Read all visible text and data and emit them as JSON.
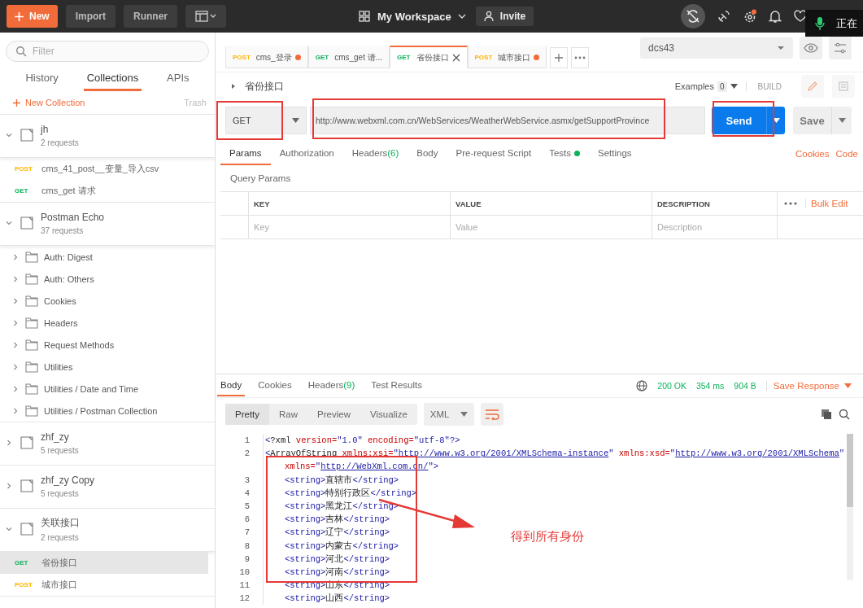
{
  "topbar": {
    "new_button": "New",
    "import_button": "Import",
    "runner_button": "Runner",
    "workspace": "My Workspace",
    "invite_button": "Invite",
    "voice_popup": "正在"
  },
  "sidebar": {
    "filter_placeholder": "Filter",
    "tabs": [
      {
        "label": "History",
        "selected": false
      },
      {
        "label": "Collections",
        "selected": true
      },
      {
        "label": "APIs",
        "selected": false
      }
    ],
    "new_collection": "New Collection",
    "trash": "Trash",
    "collections": [
      {
        "name": "jh",
        "count": "2 requests",
        "expanded": true,
        "children": [
          {
            "kind": "request",
            "method": "POST",
            "color": "#ffb400",
            "name": "cms_41_post__变量_导入csv",
            "selected": false
          },
          {
            "kind": "request",
            "method": "GET",
            "color": "#0cb25c",
            "name": "cms_get 请求",
            "selected": false
          }
        ]
      },
      {
        "name": "Postman Echo",
        "count": "37 requests",
        "expanded": true,
        "children": [
          {
            "kind": "folder",
            "name": "Auth: Digest",
            "expanded": false
          },
          {
            "kind": "folder",
            "name": "Auth: Others",
            "expanded": false
          },
          {
            "kind": "folder",
            "name": "Cookies",
            "expanded": false
          },
          {
            "kind": "folder",
            "name": "Headers",
            "expanded": false
          },
          {
            "kind": "folder",
            "name": "Request Methods",
            "expanded": false
          },
          {
            "kind": "folder",
            "name": "Utilities",
            "expanded": false
          },
          {
            "kind": "folder",
            "name": "Utilities / Date and Time",
            "expanded": false
          },
          {
            "kind": "folder",
            "name": "Utilities / Postman Collection",
            "expanded": false
          }
        ]
      },
      {
        "name": "zhf_zy",
        "count": "5 requests",
        "expanded": false
      },
      {
        "name": "zhf_zy Copy",
        "count": "5 requests",
        "expanded": false
      },
      {
        "name": "关联接口",
        "count": "2 requests",
        "expanded": true,
        "children": [
          {
            "kind": "request",
            "method": "GET",
            "color": "#0cb25c",
            "name": "省份接口",
            "selected": true
          },
          {
            "kind": "request",
            "method": "POST",
            "color": "#ffb400",
            "name": "城市接口",
            "selected": false
          }
        ]
      }
    ]
  },
  "open_tabs": [
    {
      "method": "POST",
      "color": "#ffb400",
      "name": "cms_登录",
      "selected": false,
      "unsaved": true
    },
    {
      "method": "GET",
      "color": "#0cb25c",
      "name": "cms_get 请...",
      "selected": false,
      "unsaved": false
    },
    {
      "method": "GET",
      "color": "#0cb25c",
      "name": "省份接口",
      "selected": true,
      "unsaved": false
    },
    {
      "method": "POST",
      "color": "#ffb400",
      "name": "城市接口",
      "selected": false,
      "unsaved": true
    }
  ],
  "environment": "dcs43",
  "request": {
    "name": "省份接口",
    "examples_label": "Examples",
    "examples_count": "0",
    "build_label": "BUILD",
    "method": "GET",
    "url": "http://www.webxml.com.cn/WebServices/WeatherWebService.asmx/getSupportProvince",
    "send_button": "Send",
    "save_button": "Save",
    "tabs": [
      {
        "label": "Params",
        "selected": true,
        "dot": false
      },
      {
        "label": "Authorization",
        "selected": false,
        "dot": false
      },
      {
        "label": "Headers",
        "count": "(6)",
        "selected": false,
        "dot": false
      },
      {
        "label": "Body",
        "selected": false,
        "dot": false
      },
      {
        "label": "Pre-request Script",
        "selected": false,
        "dot": false
      },
      {
        "label": "Tests",
        "selected": false,
        "dot": true
      },
      {
        "label": "Settings",
        "selected": false,
        "dot": false
      }
    ],
    "links": [
      "Cookies",
      "Code"
    ],
    "query_params_title": "Query Params",
    "columns": [
      "KEY",
      "VALUE",
      "DESCRIPTION"
    ],
    "bulk_edit": "Bulk Edit",
    "placeholders": [
      "Key",
      "Value",
      "Description"
    ]
  },
  "response": {
    "tabs": [
      {
        "label": "Body",
        "selected": true
      },
      {
        "label": "Cookies",
        "selected": false
      },
      {
        "label": "Headers",
        "count": "(9)",
        "selected": false
      },
      {
        "label": "Test Results",
        "selected": false
      }
    ],
    "status": "200 OK",
    "time": "354 ms",
    "size": "904 B",
    "save_response": "Save Response",
    "view_tabs": [
      {
        "label": "Pretty",
        "selected": true
      },
      {
        "label": "Raw",
        "selected": false
      },
      {
        "label": "Preview",
        "selected": false
      },
      {
        "label": "Visualize",
        "selected": false
      }
    ],
    "format": "XML",
    "lines": [
      {
        "number": "1",
        "indent": false,
        "tokens": [
          {
            "kind": "tag",
            "text": "<"
          },
          {
            "kind": "name",
            "text": "?xml"
          },
          {
            "kind": "attr",
            "text": " version="
          },
          {
            "kind": "value",
            "text": "\"1.0\""
          },
          {
            "kind": "attr",
            "text": " encoding="
          },
          {
            "kind": "value",
            "text": "\"utf-8\""
          },
          {
            "kind": "tag",
            "text": "?>"
          }
        ]
      },
      {
        "number": "2",
        "indent": false,
        "tokens": [
          {
            "kind": "tag",
            "text": "<"
          },
          {
            "kind": "name",
            "text": "ArrayOfString"
          },
          {
            "kind": "attr",
            "text": " xmlns:xsi="
          },
          {
            "kind": "value",
            "text": "\""
          },
          {
            "kind": "link",
            "text": "http://www.w3.org/2001/XMLSchema-instance"
          },
          {
            "kind": "value",
            "text": "\""
          },
          {
            "kind": "attr",
            "text": " xmlns:xsd="
          },
          {
            "kind": "value",
            "text": "\""
          },
          {
            "kind": "link",
            "text": "http://www.w3.org/2001/XMLSchema"
          },
          {
            "kind": "value",
            "text": "\""
          }
        ]
      },
      {
        "indent": true,
        "tokens": [
          {
            "kind": "attr",
            "text": "xmlns="
          },
          {
            "kind": "value",
            "text": "\""
          },
          {
            "kind": "link",
            "text": "http://WebXml.com.cn/"
          },
          {
            "kind": "value",
            "text": "\""
          },
          {
            "kind": "tag",
            "text": ">"
          }
        ]
      },
      {
        "number": "3",
        "indent": true,
        "tokens": [
          {
            "kind": "tag",
            "text": "<string>"
          },
          {
            "kind": "text",
            "text": "直辖市"
          },
          {
            "kind": "tag",
            "text": "</string>"
          }
        ]
      },
      {
        "number": "4",
        "indent": true,
        "tokens": [
          {
            "kind": "tag",
            "text": "<string>"
          },
          {
            "kind": "text",
            "text": "特别行政区"
          },
          {
            "kind": "tag",
            "text": "</string>"
          }
        ]
      },
      {
        "number": "5",
        "indent": true,
        "tokens": [
          {
            "kind": "tag",
            "text": "<string>"
          },
          {
            "kind": "text",
            "text": "黑龙江"
          },
          {
            "kind": "tag",
            "text": "</string>"
          }
        ]
      },
      {
        "number": "6",
        "indent": true,
        "tokens": [
          {
            "kind": "tag",
            "text": "<string>"
          },
          {
            "kind": "text",
            "text": "吉林"
          },
          {
            "kind": "tag",
            "text": "</string>"
          }
        ]
      },
      {
        "number": "7",
        "indent": true,
        "tokens": [
          {
            "kind": "tag",
            "text": "<string>"
          },
          {
            "kind": "text",
            "text": "辽宁"
          },
          {
            "kind": "tag",
            "text": "</string>"
          }
        ]
      },
      {
        "number": "8",
        "indent": true,
        "tokens": [
          {
            "kind": "tag",
            "text": "<string>"
          },
          {
            "kind": "text",
            "text": "内蒙古"
          },
          {
            "kind": "tag",
            "text": "</string>"
          }
        ]
      },
      {
        "number": "9",
        "indent": true,
        "tokens": [
          {
            "kind": "tag",
            "text": "<string>"
          },
          {
            "kind": "text",
            "text": "河北"
          },
          {
            "kind": "tag",
            "text": "</string>"
          }
        ]
      },
      {
        "number": "10",
        "indent": true,
        "tokens": [
          {
            "kind": "tag",
            "text": "<string>"
          },
          {
            "kind": "text",
            "text": "河南"
          },
          {
            "kind": "tag",
            "text": "</string>"
          }
        ]
      },
      {
        "number": "11",
        "indent": true,
        "tokens": [
          {
            "kind": "tag",
            "text": "<string>"
          },
          {
            "kind": "text",
            "text": "山东"
          },
          {
            "kind": "tag",
            "text": "</string>"
          }
        ]
      },
      {
        "number": "12",
        "indent": true,
        "tokens": [
          {
            "kind": "tag",
            "text": "<string>"
          },
          {
            "kind": "text",
            "text": "山西"
          },
          {
            "kind": "tag",
            "text": "</string>"
          }
        ]
      }
    ]
  },
  "annotation": {
    "text": "得到所有身份"
  }
}
